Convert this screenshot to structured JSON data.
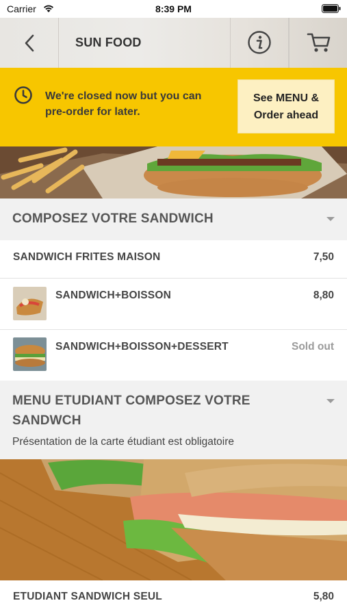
{
  "status_bar": {
    "carrier": "Carrier",
    "time": "8:39 PM"
  },
  "header": {
    "title": "SUN FOOD"
  },
  "banner": {
    "message_line1": "We're closed now but you can",
    "message_line2": "pre-order for later.",
    "button_line1": "See MENU &",
    "button_line2": "Order ahead",
    "color": "#f7c600"
  },
  "categories": [
    {
      "title": "COMPOSEZ VOTRE SANDWICH",
      "items": [
        {
          "name": "SANDWICH FRITES MAISON",
          "price": "7,50"
        },
        {
          "name": "SANDWICH+BOISSON",
          "price": "8,80"
        },
        {
          "name": "SANDWICH+BOISSON+DESSERT",
          "status": "Sold out"
        }
      ]
    },
    {
      "title_line1": "MENU ETUDIANT COMPOSEZ VOTRE",
      "title_line2": "SANDWCH",
      "subtitle": "Présentation de la carte étudiant est obligatoire",
      "items": [
        {
          "name": "ETUDIANT SANDWICH SEUL",
          "price": "5,80"
        }
      ]
    }
  ]
}
